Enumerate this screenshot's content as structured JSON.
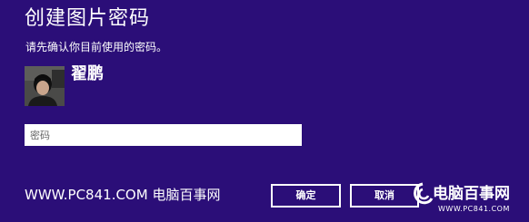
{
  "dialog": {
    "title": "创建图片密码",
    "subtitle": "请先确认你目前使用的密码。",
    "username": "翟鹏",
    "avatar_icon": "user-photo",
    "password_placeholder": "密码",
    "ok_label": "确定",
    "cancel_label": "取消"
  },
  "watermark": {
    "site_text": "WWW.PC841.COM 电脑百事网",
    "logo_name": "电脑百事网",
    "logo_url": "WWW.PC841.COM",
    "logo_icon": "swirl-logo-icon"
  },
  "colors": {
    "background": "#2b0e78",
    "text": "#ffffff",
    "input_bg": "#ffffff"
  }
}
